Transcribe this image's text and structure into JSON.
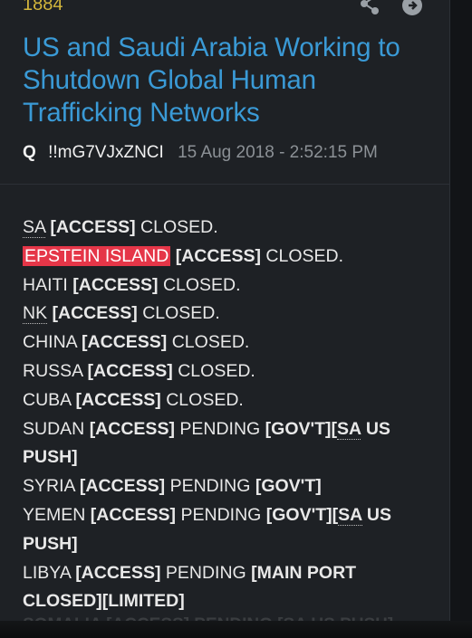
{
  "post": {
    "number": "1884",
    "title": "US and Saudi Arabia Working to Shutdown Global Human Trafficking Networks",
    "author": "Q",
    "tripcode": "!!mG7VJxZNCI",
    "timestamp": "15 Aug 2018 - 2:52:15 PM"
  },
  "icons": {
    "share": "share-icon",
    "next": "arrow-circle-icon"
  },
  "colors": {
    "title": "#3a9ad6",
    "highlight": "#e53648",
    "number": "#d4b73c"
  },
  "lines": [
    {
      "country": "SA",
      "access": "[ACCESS]",
      "status": "CLOSED."
    },
    {
      "country": "EPSTEIN ISLAND",
      "access": "[ACCESS]",
      "status": "CLOSED."
    },
    {
      "country": "HAITI",
      "access": "[ACCESS]",
      "status": "CLOSED."
    },
    {
      "country": "NK",
      "access": "[ACCESS]",
      "status": "CLOSED."
    },
    {
      "country": "CHINA",
      "access": "[ACCESS]",
      "status": "CLOSED."
    },
    {
      "country": "RUSSA",
      "access": "[ACCESS]",
      "status": "CLOSED."
    },
    {
      "country": "CUBA",
      "access": "[ACCESS]",
      "status": "CLOSED."
    },
    {
      "country": "SUDAN",
      "access": "[ACCESS]",
      "status": "PENDING",
      "tag1": "[GOV'T][",
      "tag_abbr": "SA",
      "tag2": " US PUSH]"
    },
    {
      "country": "SYRIA",
      "access": "[ACCESS]",
      "status": "PENDING",
      "tag": "[GOV'T]"
    },
    {
      "country": "YEMEN",
      "access": "[ACCESS]",
      "status": "PENDING",
      "tag1": "[GOV'T][",
      "tag_abbr": "SA",
      "tag2": " US PUSH]"
    },
    {
      "country": "LIBYA",
      "access": "[ACCESS]",
      "status": "PENDING",
      "tag": "[MAIN PORT CLOSED][LIMITED]"
    }
  ],
  "partial_line": "SOMALIA [ACCESS] PENDING [SA US PUSH]"
}
